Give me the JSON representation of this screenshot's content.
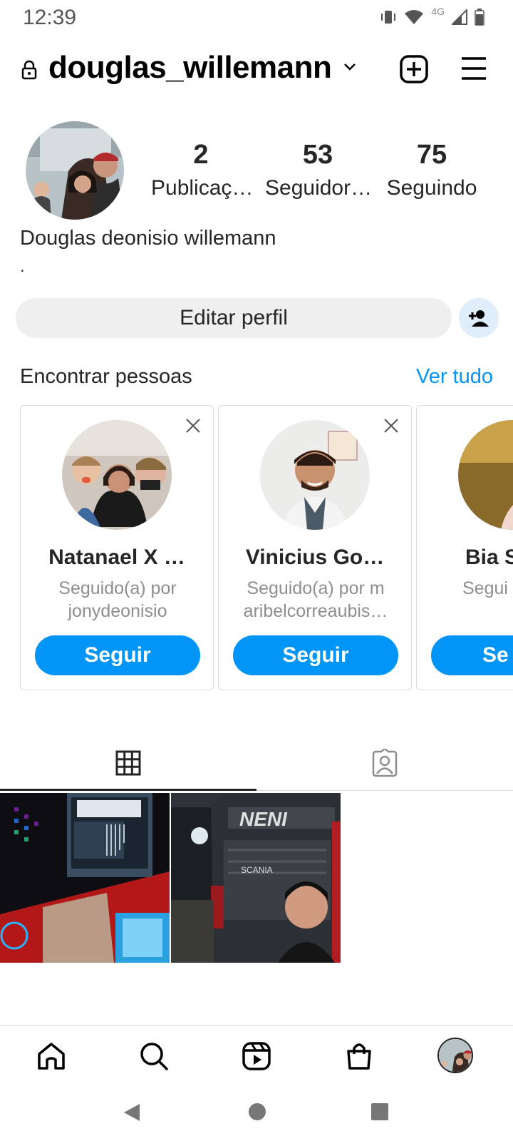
{
  "status": {
    "time": "12:39",
    "network": "4G"
  },
  "header": {
    "username": "douglas_willemann",
    "icons": [
      "lock-icon",
      "chevron-down-icon",
      "new-post-icon",
      "menu-icon"
    ]
  },
  "profile": {
    "stats": [
      {
        "number": "2",
        "label": "Publicaç…"
      },
      {
        "number": "53",
        "label": "Seguidor…"
      },
      {
        "number": "75",
        "label": "Seguindo"
      }
    ],
    "full_name": "Douglas deonisio willemann",
    "bio": ".",
    "edit_label": "Editar perfil"
  },
  "discover": {
    "title": "Encontrar pessoas",
    "see_all": "Ver tudo",
    "cards": [
      {
        "name": "Natanael X …",
        "sub_line1": "Seguido(a) por",
        "sub_line2": "jonydeonisio",
        "button": "Seguir"
      },
      {
        "name": "Vinicius Go…",
        "sub_line1": "Seguido(a) por m",
        "sub_line2": "aribelcorreaubis…",
        "button": "Seguir"
      },
      {
        "name": "Bia S",
        "sub_line1": "Segui",
        "sub_line2": "",
        "button": "Se"
      }
    ]
  },
  "tabs": [
    "grid-icon",
    "tagged-icon"
  ],
  "bottom_nav": [
    "home-icon",
    "search-icon",
    "reels-icon",
    "shop-icon",
    "profile-avatar"
  ],
  "colors": {
    "accent": "#0095f6",
    "button_grey": "#efefef",
    "text": "#262626",
    "muted": "#8e8e8e"
  }
}
